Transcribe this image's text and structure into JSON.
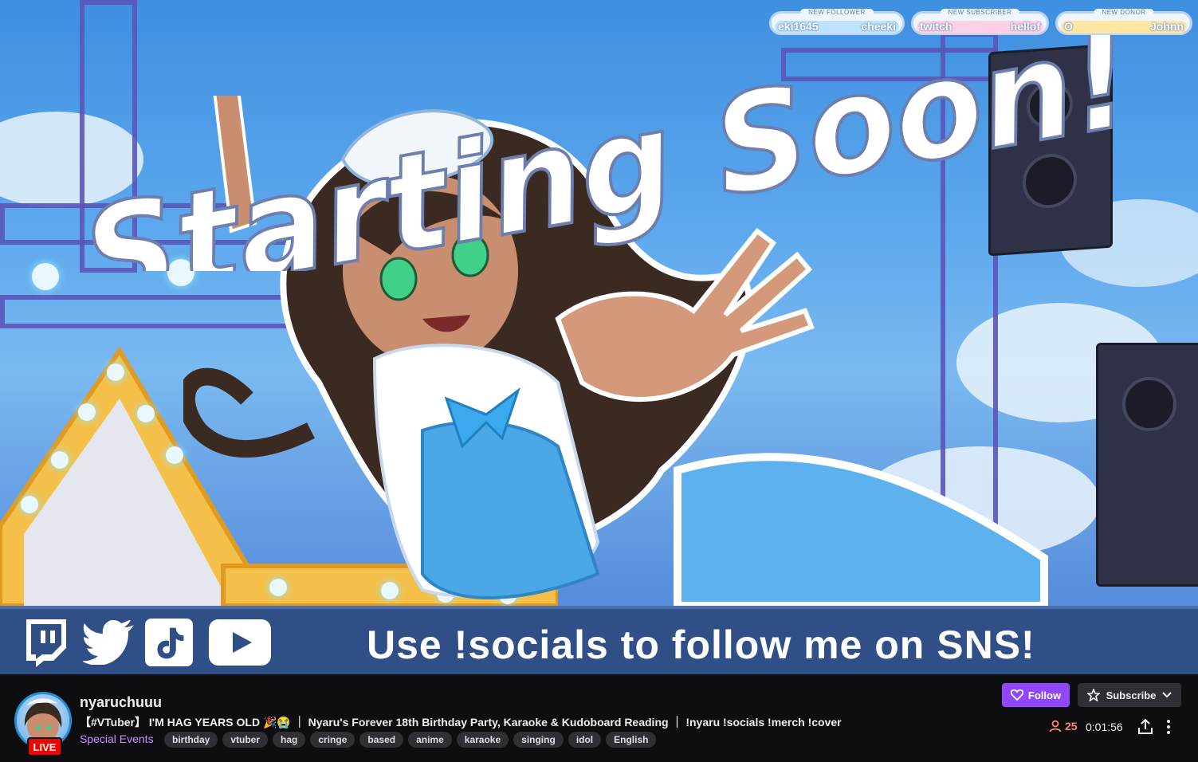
{
  "stream": {
    "overlay_heading": "Starting Soon!",
    "banner_text": "Use !socials to follow me on SNS!",
    "social_icons": [
      "twitch-icon",
      "twitter-icon",
      "tiktok-icon",
      "youtube-icon"
    ]
  },
  "alerts": [
    {
      "label": "NEW FOLLOWER",
      "left_text": "eki1645",
      "right_text": "cheeki",
      "color": "#bfe3ff"
    },
    {
      "label": "NEW SUBSCRIBER",
      "left_text": "twitch",
      "right_text": "hellof",
      "color": "#ffd0e6"
    },
    {
      "label": "NEW DONOR",
      "left_text": "O",
      "right_text": "Johnn",
      "color": "#ffe7a6"
    }
  ],
  "channel": {
    "name": "nyaruchuuu",
    "live_badge": "LIVE",
    "title": "【#VTuber】 I'M HAG YEARS OLD 🎉😭 ｜ Nyaru's Forever 18th Birthday Party, Karaoke & Kudoboard Reading ｜ !nyaru !socials !merch !cover",
    "category": "Special Events",
    "tags": [
      "birthday",
      "vtuber",
      "hag",
      "cringe",
      "based",
      "anime",
      "karaoke",
      "singing",
      "idol",
      "English"
    ]
  },
  "actions": {
    "follow_label": "Follow",
    "subscribe_label": "Subscribe",
    "viewer_count": "25",
    "uptime": "0:01:56"
  },
  "colors": {
    "brand_purple": "#9147ff",
    "live_red": "#eb0400",
    "viewer_red": "#ff8280",
    "category_purple": "#bf94ff"
  }
}
